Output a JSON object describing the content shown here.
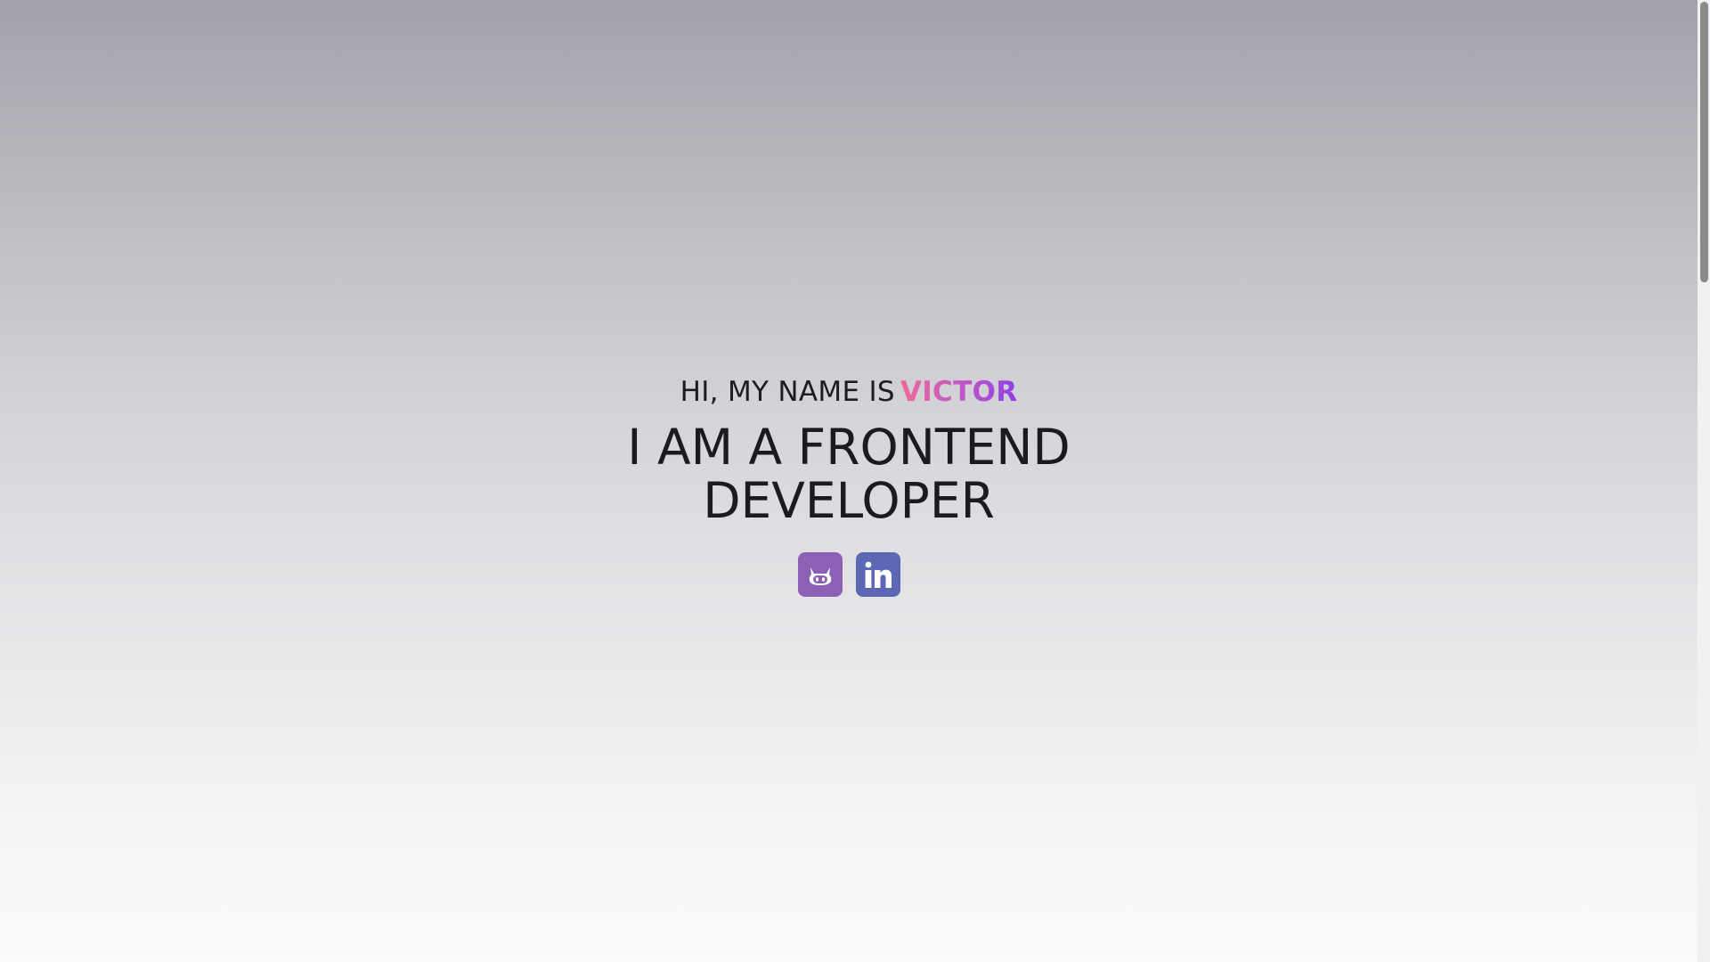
{
  "hero": {
    "greeting_prefix": "HI, MY NAME IS",
    "name": "VICTOR",
    "headline": "I AM A FRONTEND DEVELOPER"
  },
  "socials": [
    {
      "icon": "github-icon",
      "color": "#8c61b5"
    },
    {
      "icon": "linkedin-icon",
      "color": "#5d68b4"
    }
  ],
  "colors": {
    "name_gradient": [
      "#ec6a98",
      "#c557c7",
      "#8d40e6"
    ],
    "text": "#1c1c22"
  }
}
